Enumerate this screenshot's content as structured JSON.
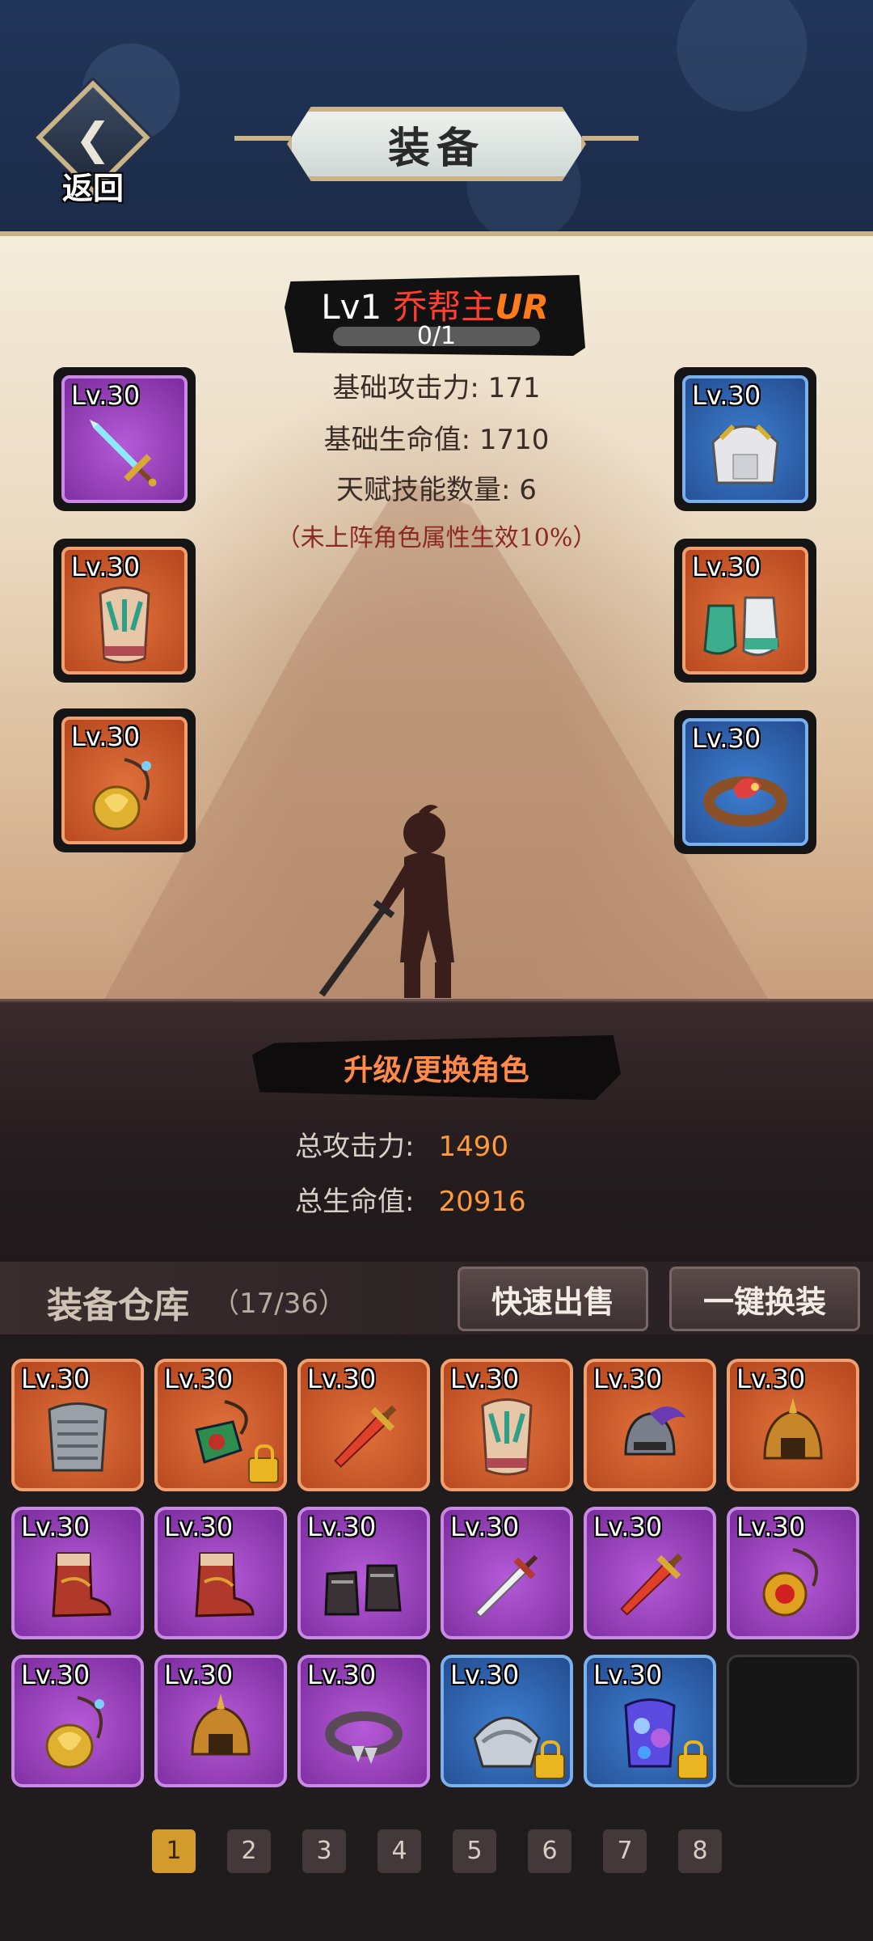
{
  "header": {
    "back_label": "返回",
    "title": "装备"
  },
  "hero": {
    "level": "Lv1",
    "name": "乔帮主",
    "rank": "UR",
    "progress": "0/1",
    "progress_fraction": 0,
    "stats": [
      "基础攻击力: 171",
      "基础生命值: 1710",
      "天赋技能数量: 6"
    ],
    "note": "（未上阵角色属性生效10%）"
  },
  "equipped": {
    "left": [
      {
        "level": "Lv.30",
        "quality": "purple",
        "item": "sword-icon"
      },
      {
        "level": "Lv.30",
        "quality": "orange",
        "item": "chest-armor-icon"
      },
      {
        "level": "Lv.30",
        "quality": "orange",
        "item": "amulet-icon"
      }
    ],
    "right": [
      {
        "level": "Lv.30",
        "quality": "blue",
        "item": "shoulder-armor-icon"
      },
      {
        "level": "Lv.30",
        "quality": "orange",
        "item": "boots-icon"
      },
      {
        "level": "Lv.30",
        "quality": "blue",
        "item": "ring-icon"
      }
    ]
  },
  "upgrade_label": "升级/更换角色",
  "totals": {
    "attack_label": "总攻击力:",
    "attack_value": "1490",
    "hp_label": "总生命值:",
    "hp_value": "20916"
  },
  "warehouse": {
    "title": "装备仓库",
    "count": "（17/36）",
    "quick_sell": "快速出售",
    "one_click_equip": "一键换装"
  },
  "inventory": [
    {
      "level": "Lv.30",
      "quality": "orange",
      "item": "chainmail-icon",
      "locked": false
    },
    {
      "level": "Lv.30",
      "quality": "orange",
      "item": "jade-pendant-icon",
      "locked": true
    },
    {
      "level": "Lv.30",
      "quality": "orange",
      "item": "red-sword-icon",
      "locked": false
    },
    {
      "level": "Lv.30",
      "quality": "orange",
      "item": "chest-armor-icon",
      "locked": false
    },
    {
      "level": "Lv.30",
      "quality": "orange",
      "item": "plumed-helmet-icon",
      "locked": false
    },
    {
      "level": "Lv.30",
      "quality": "orange",
      "item": "gold-helmet-icon",
      "locked": false
    },
    {
      "level": "Lv.30",
      "quality": "purple",
      "item": "boots-icon",
      "locked": false
    },
    {
      "level": "Lv.30",
      "quality": "purple",
      "item": "boots-icon",
      "locked": false
    },
    {
      "level": "Lv.30",
      "quality": "purple",
      "item": "dark-boots-icon",
      "locked": false
    },
    {
      "level": "Lv.30",
      "quality": "purple",
      "item": "white-sword-icon",
      "locked": false
    },
    {
      "level": "Lv.30",
      "quality": "purple",
      "item": "red-sword-icon",
      "locked": false
    },
    {
      "level": "Lv.30",
      "quality": "purple",
      "item": "gem-necklace-icon",
      "locked": false
    },
    {
      "level": "Lv.30",
      "quality": "purple",
      "item": "amulet-icon",
      "locked": false
    },
    {
      "level": "Lv.30",
      "quality": "purple",
      "item": "gold-helmet-icon",
      "locked": false
    },
    {
      "level": "Lv.30",
      "quality": "purple",
      "item": "spiked-ring-icon",
      "locked": false
    },
    {
      "level": "Lv.30",
      "quality": "blue",
      "item": "steel-pauldron-icon",
      "locked": true
    },
    {
      "level": "Lv.30",
      "quality": "blue",
      "item": "crystal-armor-icon",
      "locked": true
    },
    {
      "level": "",
      "quality": "empty",
      "item": "",
      "locked": false
    }
  ],
  "pagination": {
    "pages": [
      "1",
      "2",
      "3",
      "4",
      "5",
      "6",
      "7",
      "8"
    ],
    "current": "1"
  }
}
